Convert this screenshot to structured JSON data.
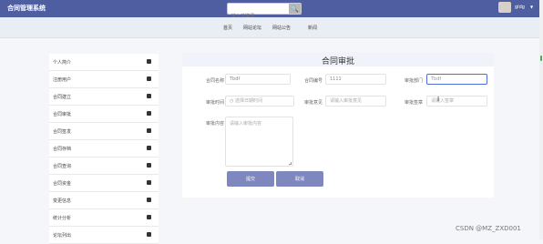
{
  "app_title": "合同管理系统",
  "search": {
    "placeholder": "输入关键词"
  },
  "user": {
    "name": "gldg"
  },
  "nav": [
    "首页",
    "网站论坛",
    "网站公告",
    "新闻"
  ],
  "sidebar": {
    "items": [
      {
        "label": "个人简介"
      },
      {
        "label": "注册用户"
      },
      {
        "label": "合同建立"
      },
      {
        "label": "合同审批"
      },
      {
        "label": "合同签发"
      },
      {
        "label": "合同存档"
      },
      {
        "label": "合同查询"
      },
      {
        "label": "合同资金"
      },
      {
        "label": "变更信息"
      },
      {
        "label": "统计分析"
      },
      {
        "label": "论坛列出"
      }
    ]
  },
  "form": {
    "title": "合同审批",
    "fields": {
      "contract_name": {
        "label": "合同名称",
        "value": "Tbdf"
      },
      "contract_no": {
        "label": "合同编号",
        "value": "1111"
      },
      "dept": {
        "label": "审批部门",
        "value": "Tbdf"
      },
      "approve_time": {
        "label": "审批时间",
        "placeholder": "选择日期时间"
      },
      "approve_opinion": {
        "label": "审批意见",
        "placeholder": "请输入审批意见"
      },
      "approver_sign": {
        "label": "审批签章",
        "placeholder": "请输入签章"
      },
      "approve_content": {
        "label": "审批内容",
        "placeholder": "请输入审批内容"
      }
    },
    "buttons": {
      "submit": "提交",
      "cancel": "取消"
    }
  },
  "watermark": "CSDN @MZ_ZXD001",
  "colors": {
    "topbar": "#4f5ea0",
    "button": "#7e88bf",
    "active_border": "#4f6fd0"
  }
}
